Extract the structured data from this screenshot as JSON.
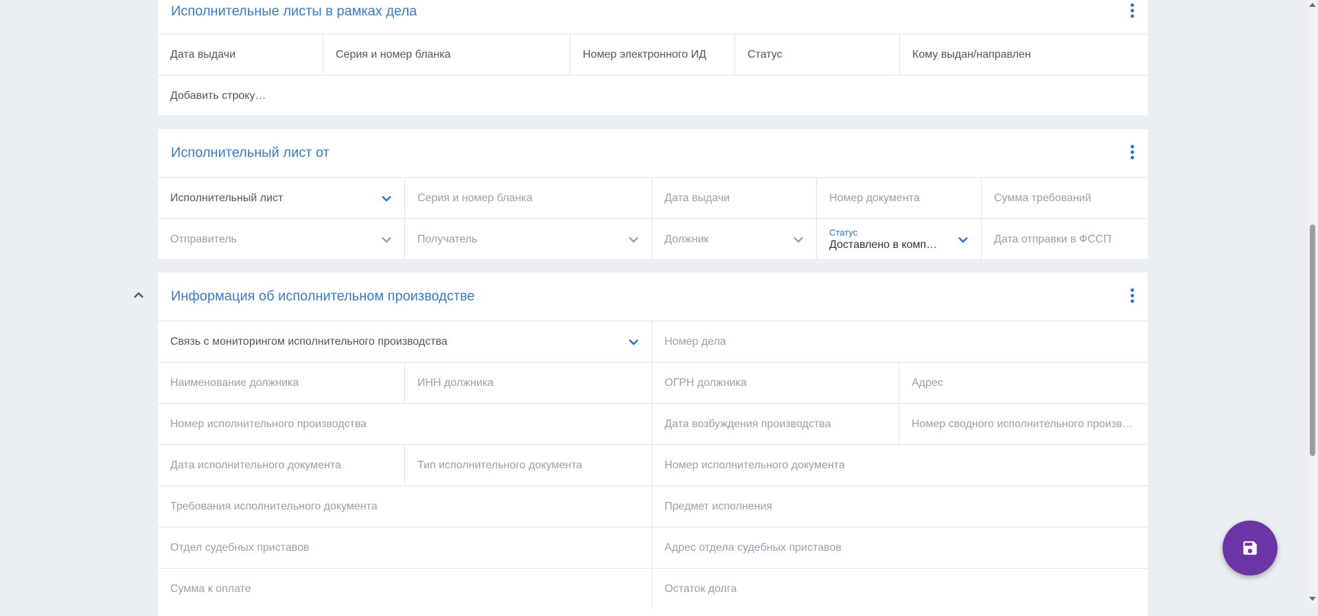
{
  "section_writs_in_case": {
    "title": "Исполнительные листы в рамках дела",
    "columns": [
      "Дата выдачи",
      "Серия и номер бланка",
      "Номер электронного ИД",
      "Статус",
      "Кому выдан/направлен"
    ],
    "add_row": "Добавить строку…"
  },
  "section_writ_from": {
    "title": "Исполнительный лист от",
    "doc_type": {
      "value": "Исполнительный лист"
    },
    "series_number": {
      "placeholder": "Серия и номер бланка"
    },
    "issue_date": {
      "placeholder": "Дата выдачи"
    },
    "document_number": {
      "placeholder": "Номер документа"
    },
    "claim_amount": {
      "placeholder": "Сумма требований"
    },
    "sender": {
      "placeholder": "Отправитель"
    },
    "recipient": {
      "placeholder": "Получатель"
    },
    "debtor": {
      "placeholder": "Должник"
    },
    "status": {
      "label": "Статус",
      "value": "Доставлено в компанию"
    },
    "fssp_send_date": {
      "placeholder": "Дата отправки в ФССП"
    }
  },
  "section_enforcement": {
    "title": "Информация об исполнительном производстве",
    "monitoring_link": {
      "value": "Связь с мониторингом исполнительного производства"
    },
    "case_number": {
      "placeholder": "Номер дела"
    },
    "debtor_name": {
      "placeholder": "Наименование должника"
    },
    "debtor_inn": {
      "placeholder": "ИНН должника"
    },
    "debtor_ogrn": {
      "placeholder": "ОГРН должника"
    },
    "address": {
      "placeholder": "Адрес"
    },
    "proceeding_number": {
      "placeholder": "Номер исполнительного производства"
    },
    "initiation_date": {
      "placeholder": "Дата возбуждения производства"
    },
    "consolidated_number": {
      "placeholder": "Номер сводного исполнительного производства"
    },
    "exec_doc_date": {
      "placeholder": "Дата исполнительного документа"
    },
    "exec_doc_type": {
      "placeholder": "Тип исполнительного документа"
    },
    "exec_doc_number": {
      "placeholder": "Номер исполнительного документа"
    },
    "exec_doc_requirements": {
      "placeholder": "Требования исполнительного документа"
    },
    "subject": {
      "placeholder": "Предмет исполнения"
    },
    "bailiff_department": {
      "placeholder": "Отдел судебных приставов"
    },
    "bailiff_department_address": {
      "placeholder": "Адрес отдела судебных приставов"
    },
    "amount_due": {
      "placeholder": "Сумма к оплате"
    },
    "debt_balance": {
      "placeholder": "Остаток долга"
    }
  },
  "colors": {
    "accent": "#3a7bc8",
    "fab": "#6b35a6",
    "background": "#eceff1"
  },
  "icons": [
    "more-vert-icon",
    "chevron-down-icon",
    "chevron-up-icon",
    "save-icon"
  ]
}
